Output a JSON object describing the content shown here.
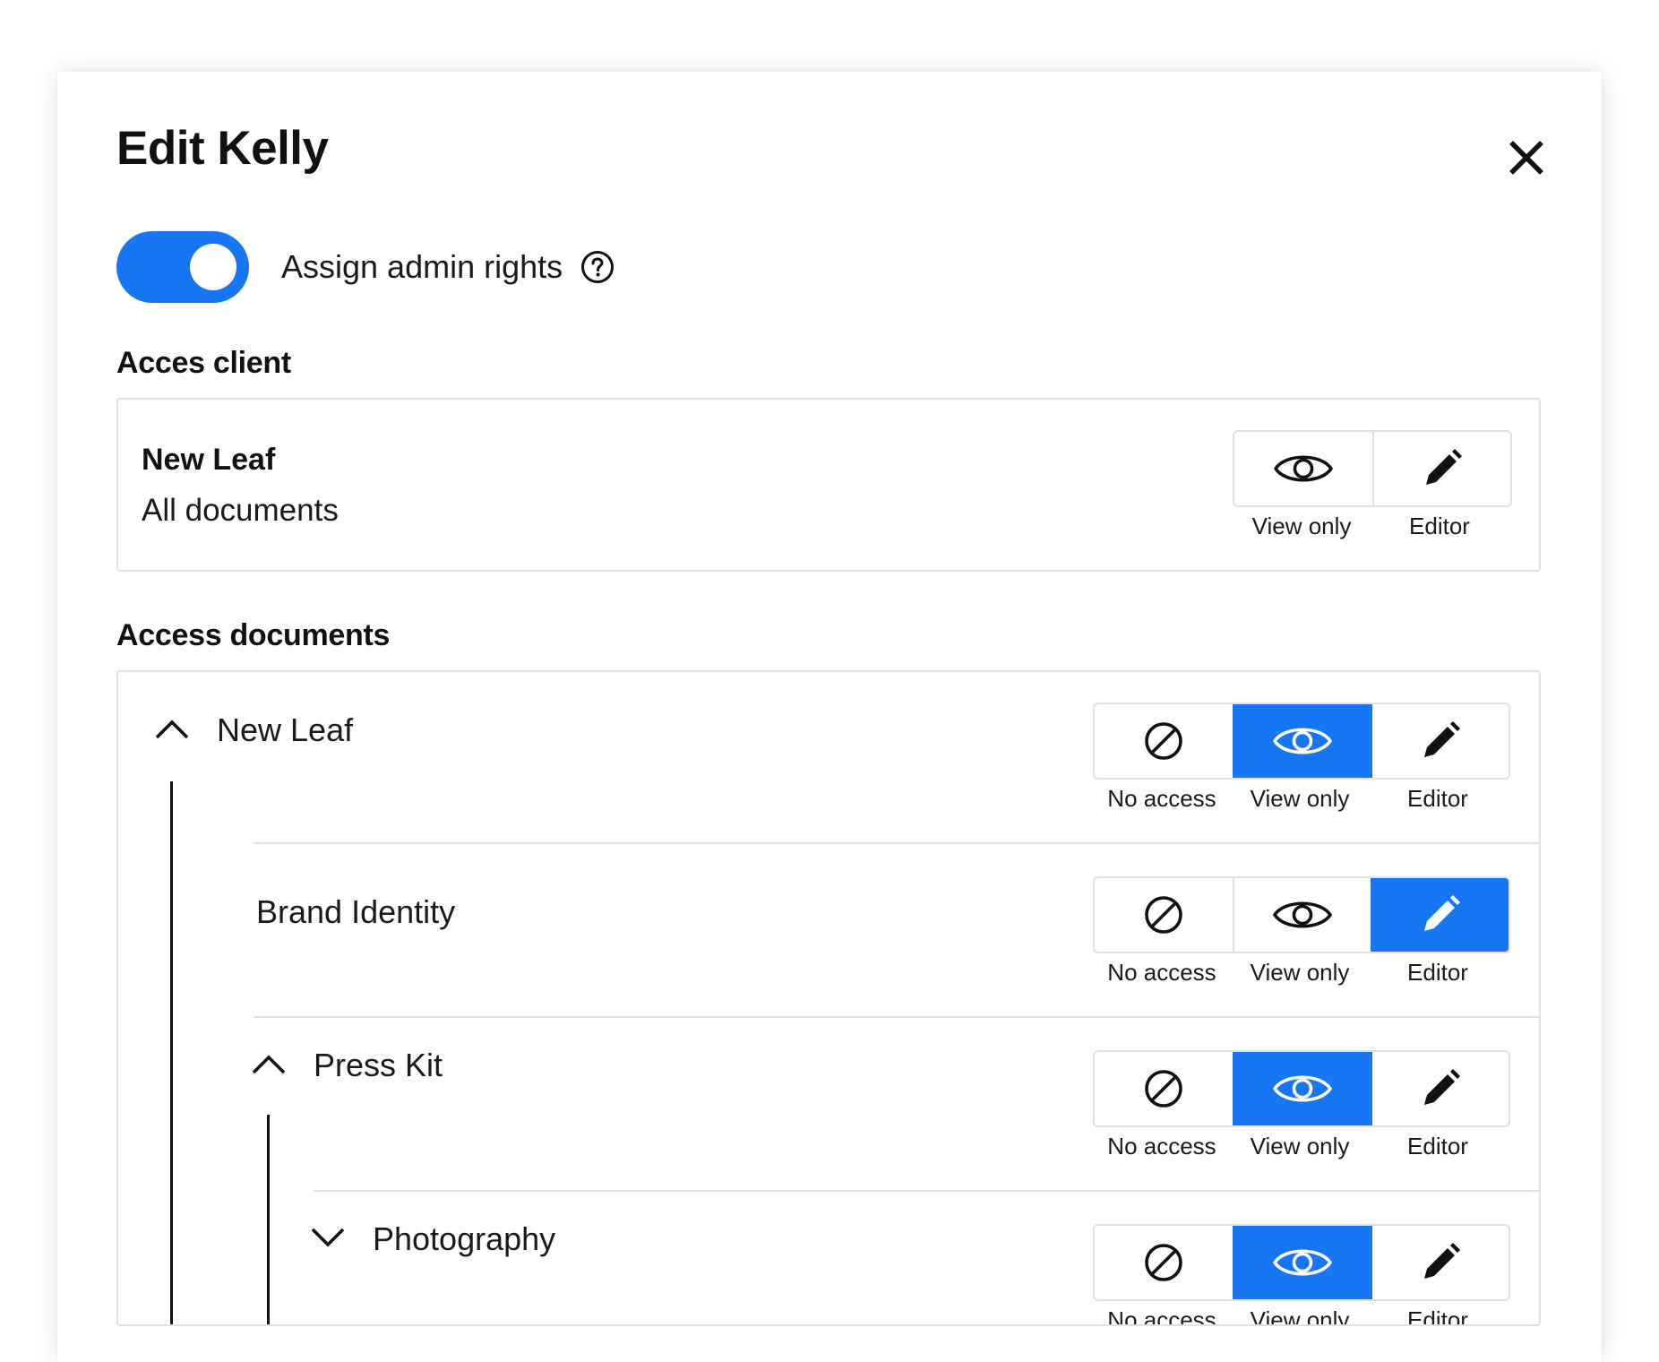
{
  "modal": {
    "title": "Edit Kelly",
    "close_icon": "close-icon",
    "admin_toggle": {
      "label": "Assign admin rights",
      "on": true,
      "help_icon": "help-circle-icon"
    }
  },
  "client_section": {
    "title": "Acces client",
    "client": {
      "name": "New Leaf",
      "subtitle": "All documents",
      "options": [
        {
          "label": "View only",
          "icon": "eye-icon"
        },
        {
          "label": "Editor",
          "icon": "pencil-icon"
        }
      ]
    }
  },
  "documents_section": {
    "title": "Access documents",
    "option_labels": {
      "no_access": "No access",
      "view_only": "View only",
      "editor": "Editor"
    },
    "rows": [
      {
        "label": "New Leaf",
        "expanded": true,
        "selected": "View only"
      },
      {
        "label": "Brand Identity",
        "selected": "Editor"
      },
      {
        "label": "Press Kit",
        "expanded": true,
        "selected": "View only"
      },
      {
        "label": "Photography",
        "expanded": false,
        "selected": "View only"
      }
    ]
  },
  "colors": {
    "accent": "#1676f3",
    "border": "#e1e1e1",
    "text": "#111111"
  }
}
